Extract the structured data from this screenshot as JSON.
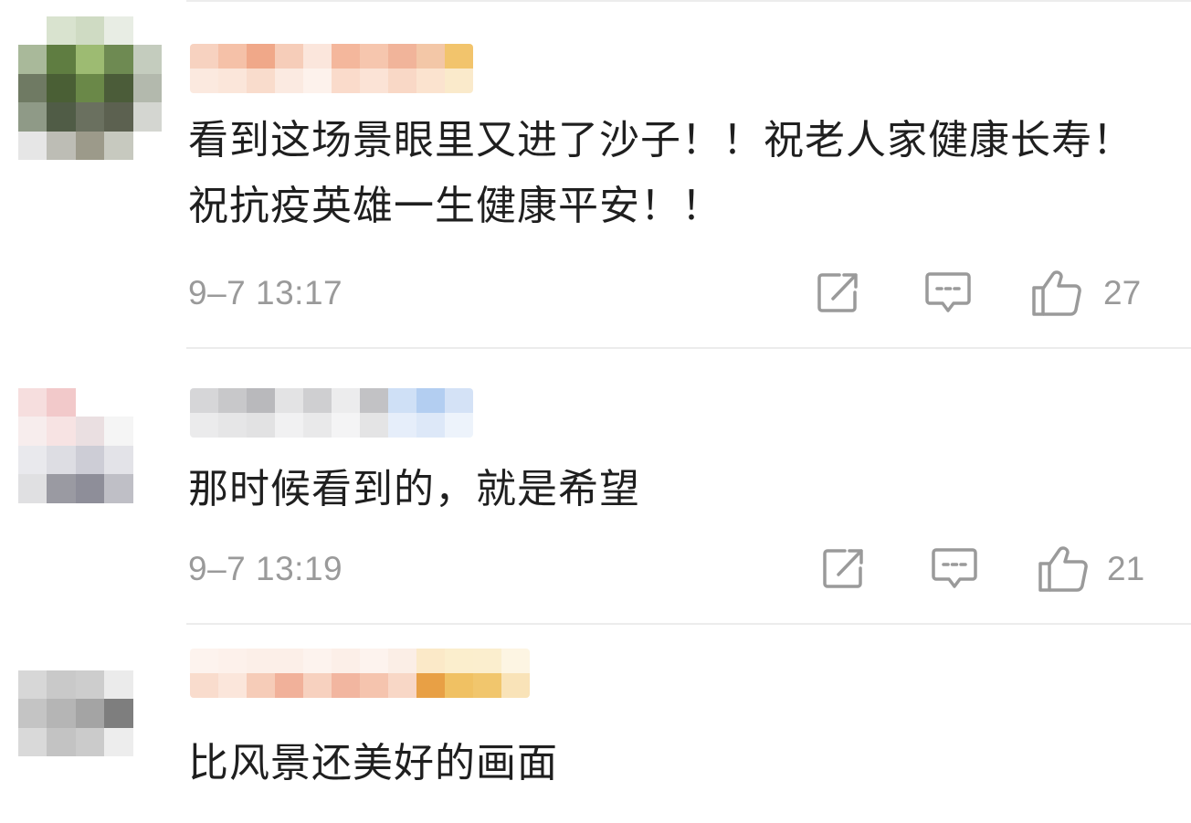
{
  "comments": [
    {
      "text": "看到这场景眼里又进了沙子！！祝老人家健康长寿！祝抗疫英雄一生健康平安！！",
      "time": "9–7 13:17",
      "likes": "27"
    },
    {
      "text": "那时候看到的，就是希望",
      "time": "9–7 13:19",
      "likes": "21"
    },
    {
      "text": "比风景还美好的画面"
    }
  ],
  "icons": {
    "share": "share-icon",
    "reply": "comment-icon",
    "like": "thumbs-up-icon"
  },
  "colors": {
    "text": "#1f1f1f",
    "meta": "#9a9a9a",
    "divider": "#ececec"
  }
}
